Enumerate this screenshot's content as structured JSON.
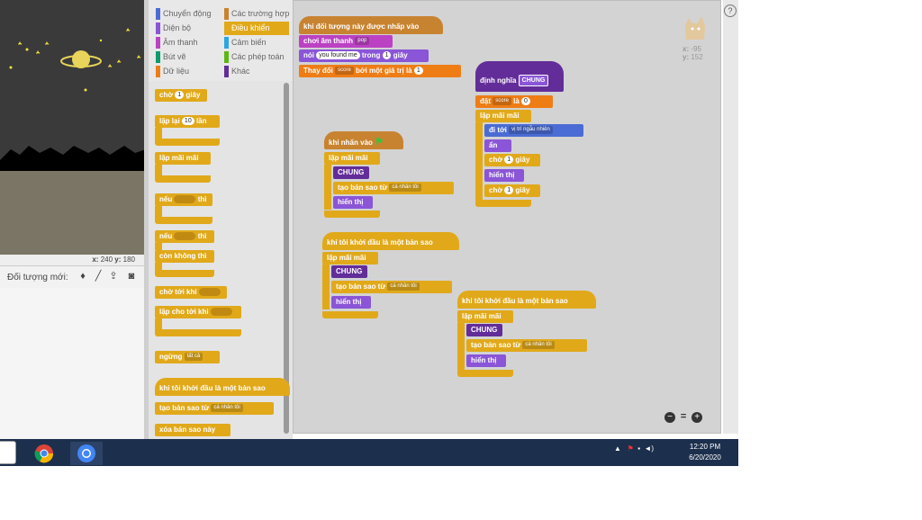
{
  "stage": {
    "coords_x": "240",
    "coords_y": "180",
    "x_label": "x:",
    "y_label": "y:"
  },
  "sprite_bar": {
    "new_sprite_label": "Đối tượng mới:"
  },
  "categories": [
    {
      "label": "Chuyển động",
      "color": "#4a6cd4"
    },
    {
      "label": "Các trường hợp",
      "color": "#c88330"
    },
    {
      "label": "Diện bộ",
      "color": "#8a55d7"
    },
    {
      "label": "Điều khiển",
      "color": "#e1a91a"
    },
    {
      "label": "Âm thanh",
      "color": "#bb42c3"
    },
    {
      "label": "Cảm biến",
      "color": "#2ca5e2"
    },
    {
      "label": "Bút vẽ",
      "color": "#0e9a6c"
    },
    {
      "label": "Các phép toán",
      "color": "#5cb712"
    },
    {
      "label": "Dữ liệu",
      "color": "#ee7d16"
    },
    {
      "label": "Khác",
      "color": "#632d99"
    }
  ],
  "palette": {
    "wait": "chờ",
    "wait_val": "1",
    "wait_unit": "giây",
    "repeat": "lặp lại",
    "repeat_val": "10",
    "repeat_unit": "lần",
    "forever": "lặp mãi mãi",
    "if": "nếu",
    "then": "thì",
    "if2": "nếu",
    "then2": "thì",
    "else": "còn không thì",
    "wait_until": "chờ tới khi",
    "repeat_until": "lặp cho tới khi",
    "stop": "ngừng",
    "stop_val": "tất cả",
    "clone_start": "khi tôi khởi đầu là một bản sao",
    "create_clone": "tạo bản sao từ",
    "create_clone_val": "cá nhân tôi",
    "delete_clone": "xóa bản sao này"
  },
  "scripts": {
    "s1_hat": "khi đối tượng này được nhấp vào",
    "s1_sound": "chơi âm thanh",
    "s1_sound_val": "pop",
    "s1_say": "nói",
    "s1_say_val": "you found me",
    "s1_say_mid": "trong",
    "s1_say_secs": "1",
    "s1_say_unit": "giây",
    "s1_change": "Thay đổi",
    "s1_change_var": "score",
    "s1_change_mid": "bởi một giá trị là",
    "s1_change_val": "1",
    "s2_hat": "khi nhấn vào",
    "s2_forever": "lặp mãi mãi",
    "s2_chung": "CHUNG",
    "s2_clone": "tạo bản sao từ",
    "s2_clone_val": "cá nhân tôi",
    "s2_show": "hiển thị",
    "s3_hat": "khi tôi khởi đầu là một bản sao",
    "s3_forever": "lặp mãi mãi",
    "s3_chung": "CHUNG",
    "s3_clone": "tạo bản sao từ",
    "s3_clone_val": "cá nhân tôi",
    "s3_show": "hiển thị",
    "s4_hat": "khi tôi khởi đầu là một bản sao",
    "s4_forever": "lặp mãi mãi",
    "s4_chung": "CHUNG",
    "s4_clone": "tạo bản sao từ",
    "s4_clone_val": "cá nhân tôi",
    "s4_show": "hiển thị",
    "def_label": "định nghĩa",
    "def_name": "CHUNG",
    "def_set": "đặt",
    "def_set_var": "score",
    "def_set_mid": "là",
    "def_set_val": "0",
    "def_forever": "lặp mãi mãi",
    "def_goto": "đi tới",
    "def_goto_val": "vị trí ngẫu nhiên",
    "def_hide": "ẩn",
    "def_wait1": "chờ",
    "def_wait1_val": "1",
    "def_wait1_unit": "giây",
    "def_show": "hiển thị",
    "def_wait2": "chờ",
    "def_wait2_val": "1",
    "def_wait2_unit": "giây"
  },
  "sprite_xy": {
    "x_label": "x:",
    "x": "-95",
    "y_label": "y:",
    "y": "152"
  },
  "zoom": {
    "out": "−",
    "reset": "=",
    "in": "+"
  },
  "help": "?",
  "taskbar": {
    "time": "12:20 PM",
    "date": "6/20/2020"
  }
}
